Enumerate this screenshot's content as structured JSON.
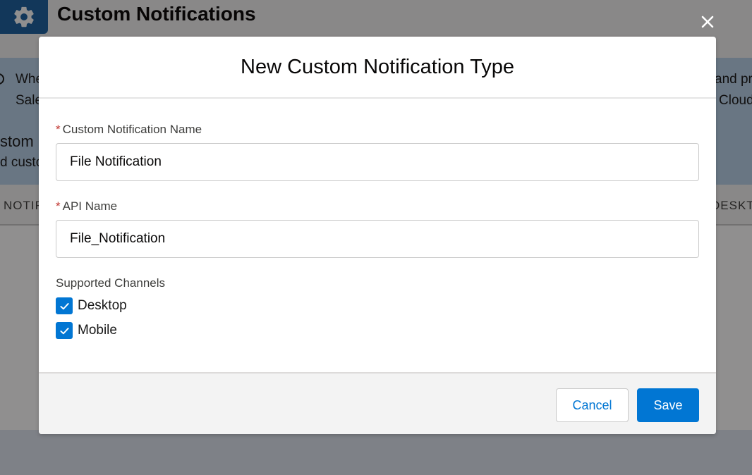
{
  "background": {
    "page_title": "Custom Notifications",
    "banner_line1_left": "Whe",
    "banner_line2_left": "Sale",
    "banner_line1_right": "and pro",
    "banner_line2_right": "Cloud",
    "section_title_fragment": "stom",
    "section_subtitle_fragment": "d custo",
    "table_col_left_fragment": "NOTIF",
    "table_col_right_fragment": "DESKTO"
  },
  "modal": {
    "title": "New Custom Notification Type",
    "fields": {
      "name": {
        "label": "Custom Notification Name",
        "required_mark": "*",
        "value": "File Notification"
      },
      "api_name": {
        "label": "API Name",
        "required_mark": "*",
        "value": "File_Notification"
      }
    },
    "channels": {
      "label": "Supported Channels",
      "options": [
        {
          "label": "Desktop",
          "checked": true
        },
        {
          "label": "Mobile",
          "checked": true
        }
      ]
    },
    "buttons": {
      "cancel": "Cancel",
      "save": "Save"
    }
  },
  "colors": {
    "brand_blue": "#0176d3",
    "required_red": "#c23934",
    "header_icon_blue": "#1b5f9e"
  },
  "icons": {
    "header": "gear-icon",
    "close": "close-icon",
    "checkbox": "check-icon",
    "banner": "info-icon"
  }
}
